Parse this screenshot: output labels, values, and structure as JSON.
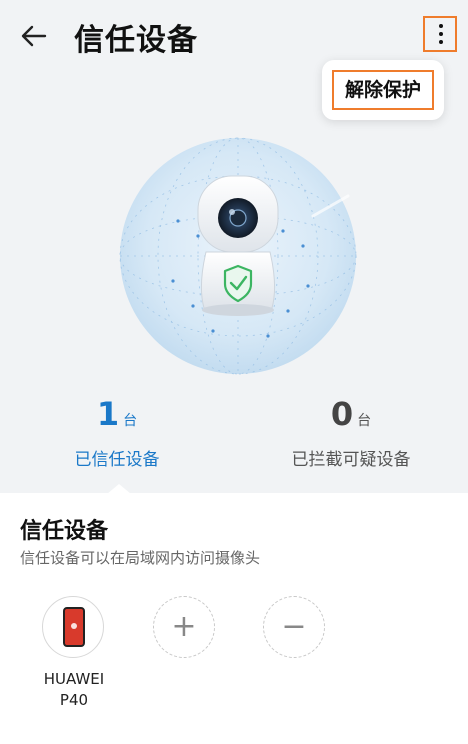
{
  "header": {
    "title": "信任设备"
  },
  "menu": {
    "unprotect_label": "解除保护"
  },
  "stats": {
    "trusted": {
      "count": "1",
      "unit": "台",
      "label": "已信任设备"
    },
    "blocked": {
      "count": "0",
      "unit": "台",
      "label": "已拦截可疑设备"
    }
  },
  "section": {
    "title": "信任设备",
    "subtitle": "信任设备可以在局域网内访问摄像头"
  },
  "devices": [
    {
      "name_line1": "HUAWEI",
      "name_line2": "P40"
    }
  ],
  "icons": {
    "back": "back-arrow-icon",
    "more": "more-vertical-icon",
    "camera": "security-camera-icon",
    "shield": "shield-check-icon",
    "add": "plus-icon",
    "remove": "minus-icon"
  },
  "colors": {
    "accent": "#1a78c8",
    "shield": "#3cb562",
    "highlight": "#ef7c2c"
  }
}
